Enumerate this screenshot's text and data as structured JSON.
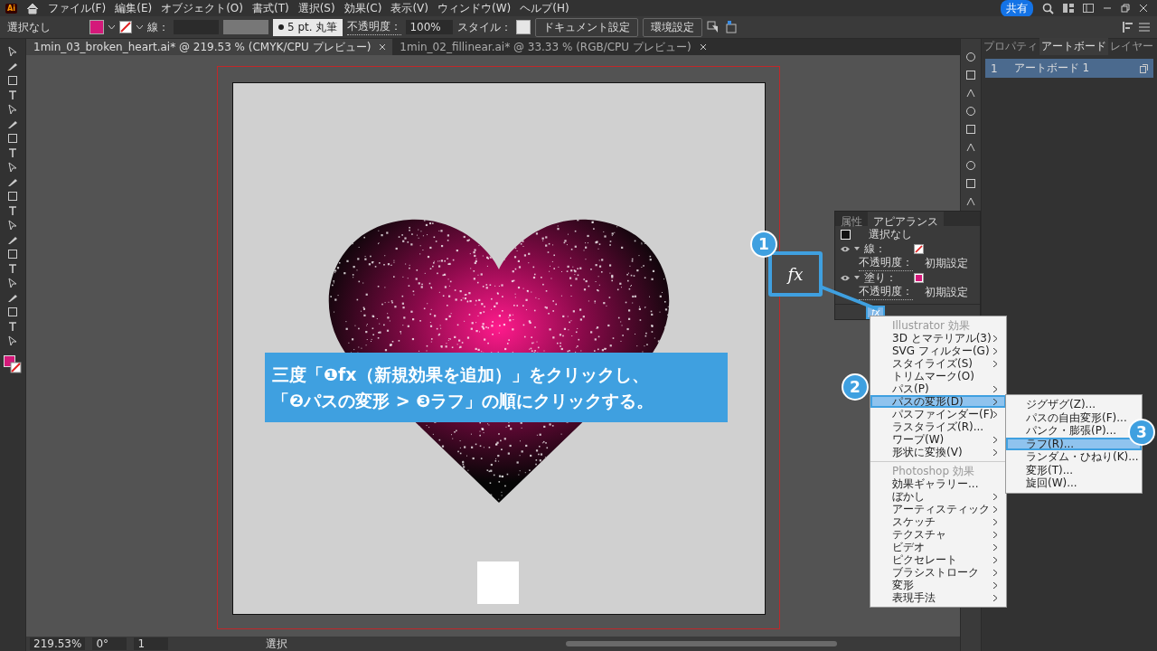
{
  "menubar": {
    "logo": "Ai",
    "items": [
      "ファイル(F)",
      "編集(E)",
      "オブジェクト(O)",
      "書式(T)",
      "選択(S)",
      "効果(C)",
      "表示(V)",
      "ウィンドウ(W)",
      "ヘルプ(H)"
    ],
    "share": "共有"
  },
  "control_bar": {
    "selection": "選択なし",
    "stroke_label": "線：",
    "brush": "5 pt. 丸筆",
    "opacity_label": "不透明度：",
    "opacity": "100%",
    "style_label": "スタイル：",
    "buttons": [
      "ドキュメント設定",
      "環境設定"
    ]
  },
  "doc_tabs": [
    {
      "title": "1min_03_broken_heart.ai* @ 219.53 % (CMYK/CPU プレビュー)",
      "selected": true
    },
    {
      "title": "1min_02_fillinear.ai* @ 33.33 % (RGB/CPU プレビュー)",
      "selected": false
    }
  ],
  "right_panel": {
    "tabs": [
      {
        "label": "プロパティ",
        "selected": false
      },
      {
        "label": "アートボード",
        "selected": true
      },
      {
        "label": "レイヤー",
        "selected": false
      }
    ],
    "rows": [
      {
        "number": "1",
        "name": "アートボード 1",
        "selected": true
      }
    ]
  },
  "appearance_panel": {
    "tabs": [
      {
        "label": "属性",
        "selected": false
      },
      {
        "label": "アピアランス",
        "selected": true
      }
    ],
    "rows": [
      {
        "kind": "object",
        "label": "選択なし"
      },
      {
        "kind": "stroke",
        "label": "線："
      },
      {
        "kind": "opacity",
        "label": "不透明度：",
        "value": "初期設定"
      },
      {
        "kind": "fill",
        "label": "塗り："
      },
      {
        "kind": "opacity",
        "label": "不透明度：",
        "value": "初期設定"
      }
    ],
    "fx_button": "fx"
  },
  "callout": {
    "fx": "fx",
    "caption": [
      "三度「❶fx（新規効果を追加）」をクリックし、",
      "「❷パスの変形 > ❸ラフ」の順にクリックする。"
    ],
    "steps": [
      "1",
      "2",
      "3"
    ]
  },
  "effects_menu": [
    {
      "kind": "header",
      "label": "Illustrator 効果"
    },
    {
      "kind": "item",
      "label": "3D とマテリアル(3)",
      "submenu": true,
      "selected": false
    },
    {
      "kind": "item",
      "label": "SVG フィルター(G)",
      "submenu": true,
      "selected": false
    },
    {
      "kind": "item",
      "label": "スタイライズ(S)",
      "submenu": true,
      "selected": false
    },
    {
      "kind": "item",
      "label": "トリムマーク(O)",
      "submenu": false,
      "selected": false
    },
    {
      "kind": "item",
      "label": "パス(P)",
      "submenu": true,
      "selected": false
    },
    {
      "kind": "item",
      "label": "パスの変形(D)",
      "submenu": true,
      "selected": true
    },
    {
      "kind": "item",
      "label": "パスファインダー(F)",
      "submenu": true,
      "selected": false
    },
    {
      "kind": "item",
      "label": "ラスタライズ(R)...",
      "submenu": false,
      "selected": false
    },
    {
      "kind": "item",
      "label": "ワープ(W)",
      "submenu": true,
      "selected": false
    },
    {
      "kind": "item",
      "label": "形状に変換(V)",
      "submenu": true,
      "selected": false
    },
    {
      "kind": "separator"
    },
    {
      "kind": "header",
      "label": "Photoshop 効果"
    },
    {
      "kind": "item",
      "label": "効果ギャラリー...",
      "submenu": false,
      "selected": false
    },
    {
      "kind": "item",
      "label": "ぼかし",
      "submenu": true,
      "selected": false
    },
    {
      "kind": "item",
      "label": "アーティスティック",
      "submenu": true,
      "selected": false
    },
    {
      "kind": "item",
      "label": "スケッチ",
      "submenu": true,
      "selected": false
    },
    {
      "kind": "item",
      "label": "テクスチャ",
      "submenu": true,
      "selected": false
    },
    {
      "kind": "item",
      "label": "ビデオ",
      "submenu": true,
      "selected": false
    },
    {
      "kind": "item",
      "label": "ピクセレート",
      "submenu": true,
      "selected": false
    },
    {
      "kind": "item",
      "label": "ブラシストローク",
      "submenu": true,
      "selected": false
    },
    {
      "kind": "item",
      "label": "変形",
      "submenu": true,
      "selected": false
    },
    {
      "kind": "item",
      "label": "表現手法",
      "submenu": true,
      "selected": false
    }
  ],
  "submenu": [
    {
      "label": "ジグザグ(Z)...",
      "selected": false
    },
    {
      "label": "パスの自由変形(F)...",
      "selected": false
    },
    {
      "label": "パンク・膨張(P)...",
      "selected": false
    },
    {
      "label": "ラフ(R)...",
      "selected": true
    },
    {
      "label": "ランダム・ひねり(K)...",
      "selected": false
    },
    {
      "label": "変形(T)...",
      "selected": false
    },
    {
      "label": "旋回(W)...",
      "selected": false
    }
  ],
  "status_bar": {
    "zoom": "219.53%",
    "rotation": "0°",
    "artboard": "1",
    "mode": "選択"
  }
}
